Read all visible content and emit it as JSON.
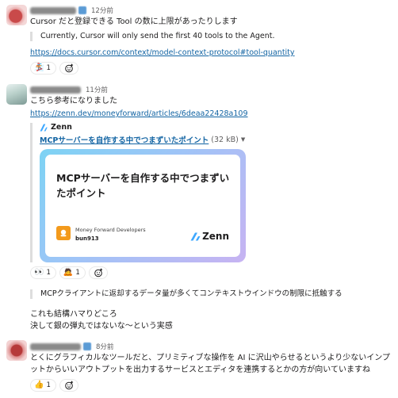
{
  "messages": [
    {
      "time": "12分前",
      "text": "Cursor だと登録できる Tool の数に上限があったりします",
      "quote": "Currently, Cursor will only send the first 40 tools to the Agent.",
      "link": "https://docs.cursor.com/context/model-context-protocol#tool-quantity",
      "reactions": [
        {
          "emoji": "🏂",
          "count": "1",
          "emoji_name": "reaction-icon"
        }
      ]
    },
    {
      "time": "11分前",
      "text": "こちら参考になりました",
      "link": "https://zenn.dev/moneyforward/articles/6deaa22428a109",
      "attachment": {
        "site": "Zenn",
        "title": "MCPサーバーを自作する中でつまずいたポイント",
        "size": "(32 kB)",
        "card_title": "MCPサーバーを自作する中でつまずいたポイント",
        "publisher": "Money Forward Developers",
        "author": "bun913",
        "brand": "Zenn"
      },
      "reactions": [
        {
          "emoji": "👀",
          "count": "1"
        },
        {
          "emoji": "🙇",
          "count": "1"
        }
      ],
      "followup_quote": "MCPクライアントに返却するデータ量が多くてコンテキストウインドウの制限に抵触する",
      "followup_lines": [
        "これも結構ハマりどころ",
        "決して銀の弾丸ではないな〜という実感"
      ]
    },
    {
      "time": "8分前",
      "text_lines": [
        "とくにグラフィカルなツールだと、プリミティブな操作を AI に沢山やらせるというより少ないインプ",
        "ットからいいアウトプットを出力するサービスとエディタを連携するとかの方が向いていますね"
      ],
      "reactions": [
        {
          "emoji": "👍",
          "count": "1"
        }
      ]
    }
  ],
  "colors": {
    "link": "#1264a3",
    "text": "#1d1c1d",
    "muted": "#616061",
    "quote_bar": "#dddddd",
    "card_gradient_start": "#7dd3f4",
    "card_gradient_end": "#c7b3f2",
    "logo_orange": "#f39a1c"
  }
}
